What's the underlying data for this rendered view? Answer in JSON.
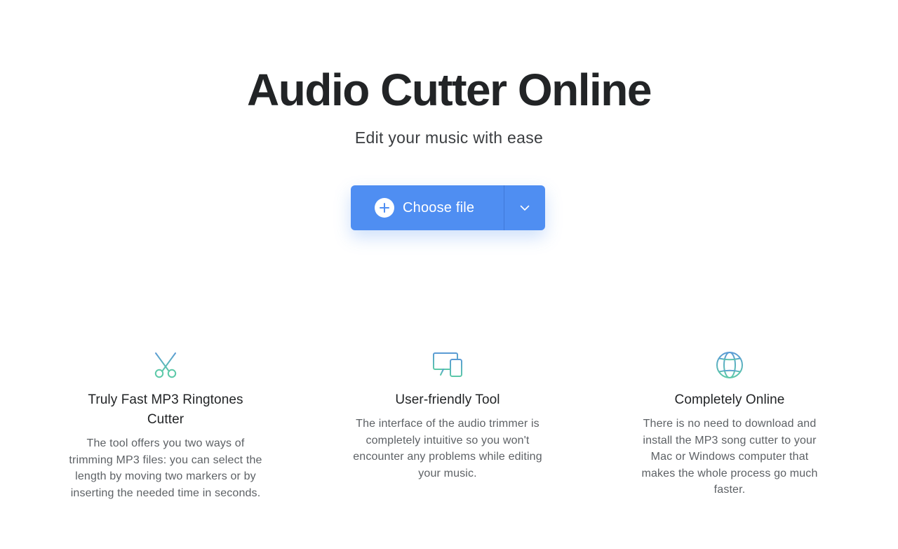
{
  "hero": {
    "title": "Audio Cutter Online",
    "subtitle": "Edit your music with ease"
  },
  "upload": {
    "choose_label": "Choose file",
    "plus_icon": "plus-circle-icon",
    "dropdown_icon": "chevron-down-icon",
    "button_color": "#4f8ef2"
  },
  "features": [
    {
      "icon": "scissors-icon",
      "title": "Truly Fast MP3 Ringtones Cutter",
      "description": "The tool offers you two ways of trimming MP3 files: you can select the length by moving two markers or by inserting the needed time in seconds."
    },
    {
      "icon": "devices-icon",
      "title": "User-friendly Tool",
      "description": "The interface of the audio trimmer is completely intuitive so you won't encounter any problems while editing your music."
    },
    {
      "icon": "globe-icon",
      "title": "Completely Online",
      "description": "There is no need to download and install the MP3 song cutter to your Mac or Windows computer that makes the whole process go much faster."
    }
  ],
  "colors": {
    "icon_gradient_start": "#5b9bd5",
    "icon_gradient_end": "#5cc9a8",
    "text_primary": "#222426",
    "text_secondary": "#5d6165"
  }
}
